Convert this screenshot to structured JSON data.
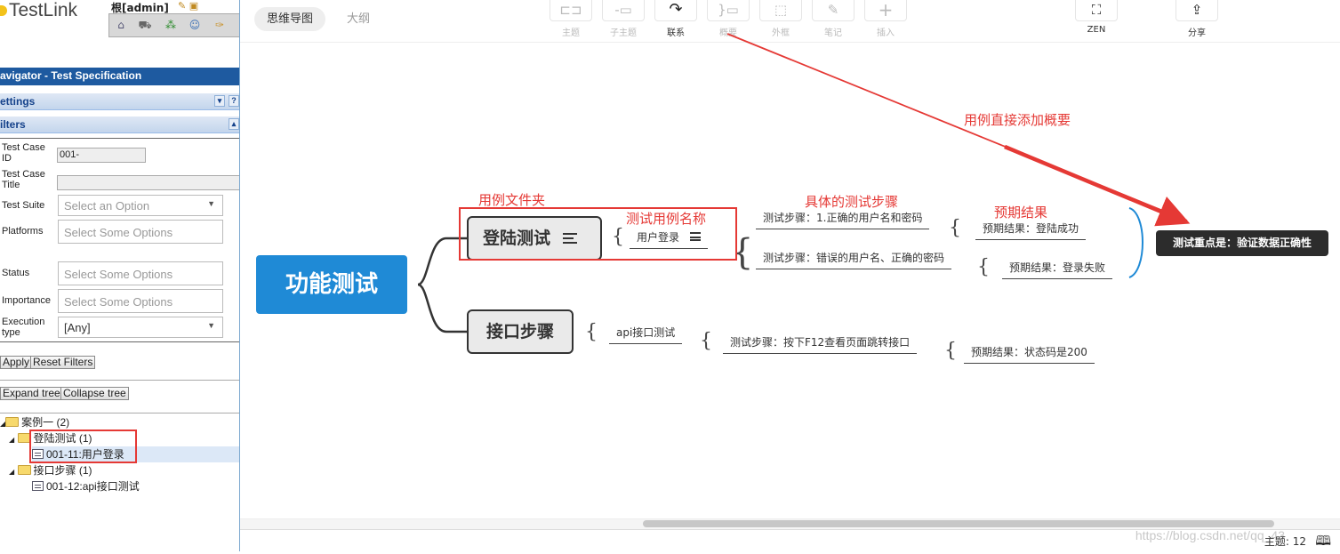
{
  "testlink": {
    "logo_text": "TestLink",
    "user": "根[admin]",
    "toolbar_icons": [
      "home-icon",
      "cart-icon",
      "sitemap-icon",
      "user-icon",
      "broom-icon"
    ],
    "navigator_title": "avigator - Test Specification",
    "settings_label": "ettings",
    "filters_label": "ilters",
    "filters": {
      "tc_id_label": "Test Case ID",
      "tc_id_value": "001-",
      "tc_title_label": "Test Case Title",
      "suite_label": "Test Suite",
      "suite_value": "Select an Option",
      "platforms_label": "Platforms",
      "platforms_placeholder": "Select Some Options",
      "status_label": "Status",
      "status_placeholder": "Select Some Options",
      "importance_label": "Importance",
      "importance_placeholder": "Select Some Options",
      "exec_type_label": "Execution type",
      "exec_type_value": "[Any]"
    },
    "apply_label": "Apply",
    "reset_label": "Reset Filters",
    "expand_label": "Expand tree",
    "collapse_label": "Collapse tree",
    "tree": [
      {
        "label": "案例一 (2)"
      },
      {
        "label": "登陆测试 (1)"
      },
      {
        "label": "001-11:用户登录"
      },
      {
        "label": "接口步骤 (1)"
      },
      {
        "label": "001-12:api接口测试"
      }
    ]
  },
  "mindmap": {
    "tabs": [
      "思维导图",
      "大纲"
    ],
    "tools": [
      {
        "label": "主题",
        "icon": "topic-icon"
      },
      {
        "label": "子主题",
        "icon": "subtopic-icon"
      },
      {
        "label": "联系",
        "icon": "relation-icon"
      },
      {
        "label": "概要",
        "icon": "summary-icon"
      },
      {
        "label": "外框",
        "icon": "boundary-icon"
      },
      {
        "label": "笔记",
        "icon": "note-icon"
      },
      {
        "label": "插入",
        "icon": "insert-icon"
      }
    ],
    "zen_label": "ZEN",
    "share_label": "分享",
    "root": "功能测试",
    "main1": "登陆测试",
    "main2": "接口步骤",
    "case1": "用户登录",
    "step1": "测试步骤：1.正确的用户名和密码",
    "step2": "测试步骤：错误的用户名、正确的密码",
    "expect1": "预期结果：登陆成功",
    "expect2": "预期结果：登录失败",
    "case2": "api接口测试",
    "step3": "测试步骤：按下F12查看页面跳转接口",
    "expect3": "预期结果：状态码是200",
    "summary": "测试重点是：验证数据正确性",
    "annotations": {
      "folder": "用例文件夹",
      "case_name": "测试用例名称",
      "steps": "具体的测试步骤",
      "expected": "预期结果",
      "summary_note": "用例直接添加概要"
    },
    "topic_count": "主题: 12",
    "watermark": "https://blog.csdn.net/qq_43"
  },
  "colors": {
    "accent_blue": "#1f8ad6",
    "annotation_red": "#e53935",
    "nav_blue": "#1e5aa0",
    "summary_dark": "#2c2c2c"
  }
}
